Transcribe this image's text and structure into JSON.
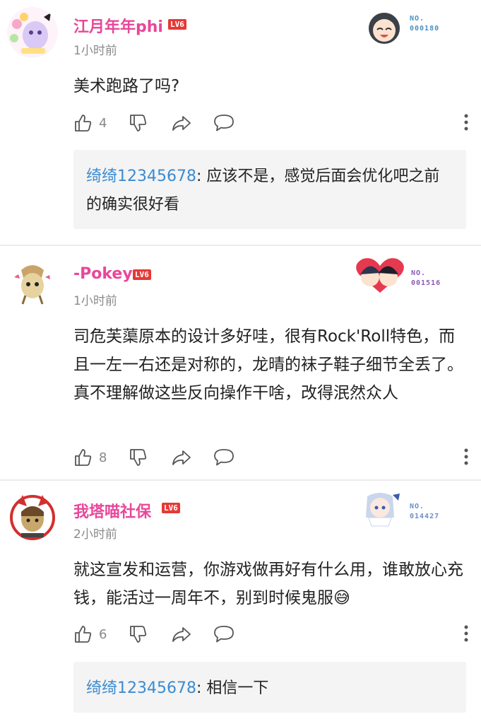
{
  "comments": [
    {
      "username": "江月年年phi",
      "level": "LV6",
      "time": "1小时前",
      "badge_no": "NO.",
      "badge_num": "000180",
      "content": "美术跑路了吗?",
      "likes": "4",
      "reply_author": "绮绮12345678",
      "reply_text": ": 应该不是，感觉后面会优化吧之前的确实很好看",
      "name_color": "#e8479a",
      "badge_color": "#4a90c0"
    },
    {
      "username": "-Pokey",
      "level": "LV6",
      "time": "1小时前",
      "badge_no": "NO.",
      "badge_num": "001516",
      "content": "司危芙蕖原本的设计多好哇，很有Rock'Roll特色，而且一左一右还是对称的，龙晴的袜子鞋子细节全丢了。真不理解做这些反向操作干啥，改得泯然众人",
      "likes": "8",
      "name_color": "#e8479a",
      "badge_color": "#8a5ab8"
    },
    {
      "username": "我塔喵社保",
      "level": "LV6",
      "time": "2小时前",
      "badge_no": "NO.",
      "badge_num": "014427",
      "content": "就这宣发和运营，你游戏做再好有什么用，谁敢放心充钱，能活过一周年不，别到时候鬼服😅",
      "likes": "6",
      "reply_author": "绮绮12345678",
      "reply_text": ": 相信一下",
      "name_color": "#e8479a",
      "badge_color": "#6a8fc8"
    }
  ]
}
